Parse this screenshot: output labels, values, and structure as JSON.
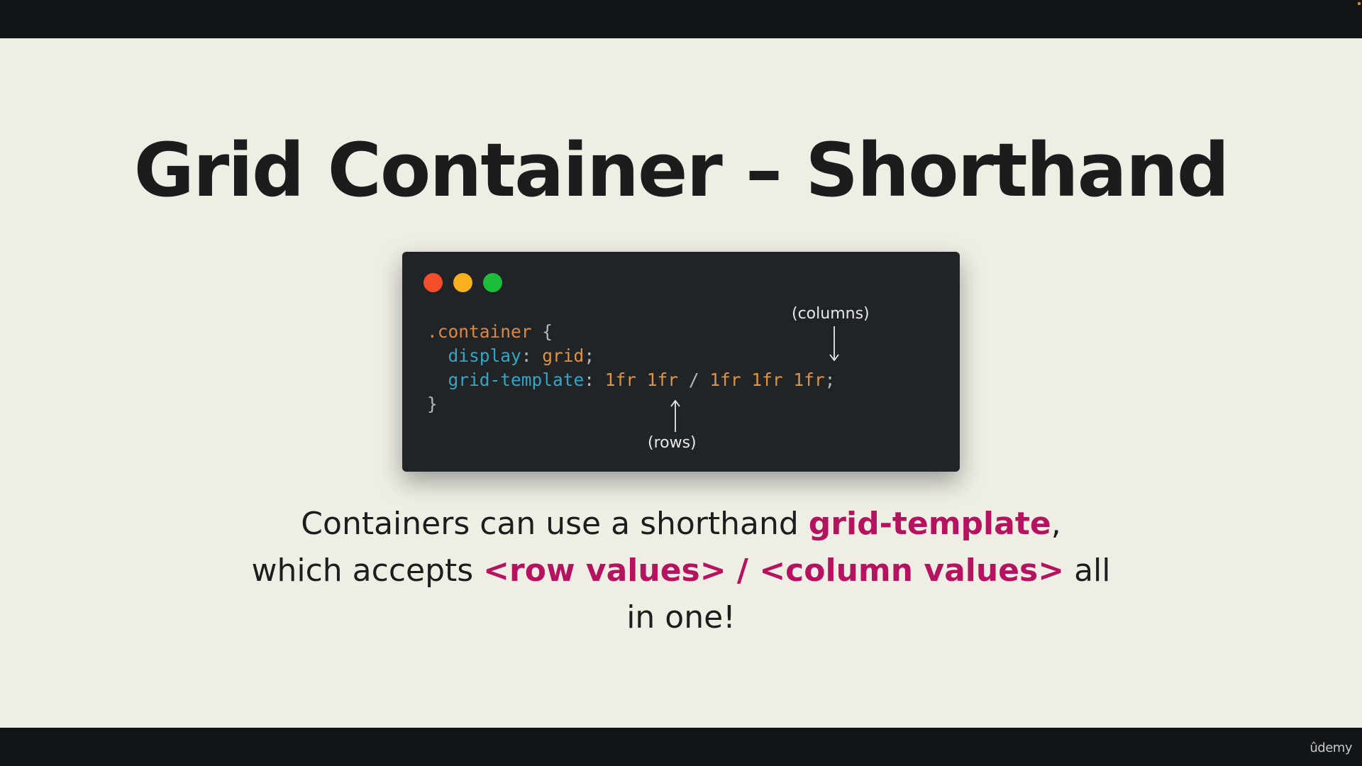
{
  "slide": {
    "title": "Grid Container – Shorthand",
    "description": {
      "line1_pre": "Containers can use a shorthand ",
      "line1_hl": "grid-template",
      "line1_post": ",",
      "line2_pre": "which accepts ",
      "line2_hl": "<row values> / <column values>",
      "line2_post": " all",
      "line3": "in one!"
    }
  },
  "code_window": {
    "lines": {
      "selector": ".container",
      "open_brace": " {",
      "prop1": "display",
      "colon1": ": ",
      "val1": "grid",
      "semi1": ";",
      "prop2": "grid-template",
      "colon2": ": ",
      "val2a": "1fr 1fr",
      "slash": " / ",
      "val2b": "1fr 1fr 1fr",
      "semi2": ";",
      "close_brace": "}"
    },
    "annotations": {
      "columns": "(columns)",
      "rows": "(rows)"
    },
    "traffic_light_colors": {
      "red": "#f44d2c",
      "yellow": "#f7b11e",
      "green": "#1bbd3a"
    }
  },
  "branding": {
    "logo_text": "ûdemy"
  },
  "colors": {
    "highlight": "#b5135f",
    "slide_background": "#efeee5",
    "code_background": "#202427"
  }
}
